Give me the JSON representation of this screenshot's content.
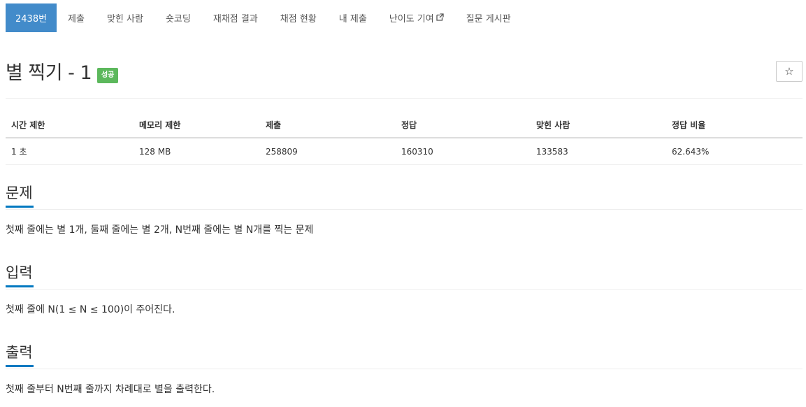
{
  "tabs": [
    {
      "label": "2438번",
      "active": true
    },
    {
      "label": "제출",
      "active": false
    },
    {
      "label": "맞힌 사람",
      "active": false
    },
    {
      "label": "숏코딩",
      "active": false
    },
    {
      "label": "재채점 결과",
      "active": false
    },
    {
      "label": "채점 현황",
      "active": false
    },
    {
      "label": "내 제출",
      "active": false
    },
    {
      "label": "난이도 기여",
      "active": false,
      "external": true
    },
    {
      "label": "질문 게시판",
      "active": false
    }
  ],
  "problem": {
    "title": "별 찍기 - 1",
    "badge": "성공",
    "star_icon": "☆"
  },
  "info": {
    "headers": [
      "시간 제한",
      "메모리 제한",
      "제출",
      "정답",
      "맞힌 사람",
      "정답 비율"
    ],
    "values": [
      "1 초",
      "128 MB",
      "258809",
      "160310",
      "133583",
      "62.643%"
    ]
  },
  "sections": {
    "description": {
      "title": "문제",
      "body": "첫째 줄에는 별 1개, 둘째 줄에는 별 2개, N번째 줄에는 별 N개를 찍는 문제"
    },
    "input": {
      "title": "입력",
      "body": "첫째 줄에 N(1 ≤ N ≤ 100)이 주어진다."
    },
    "output": {
      "title": "출력",
      "body": "첫째 줄부터 N번째 줄까지 차례대로 별을 출력한다."
    }
  },
  "colors": {
    "active_tab": "#428bca",
    "badge": "#5cb85c",
    "section_underline": "#0078c0"
  }
}
